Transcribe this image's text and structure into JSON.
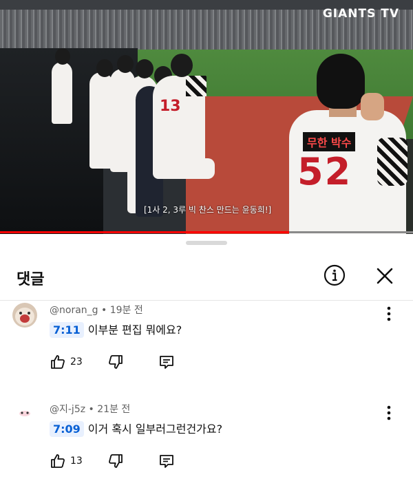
{
  "video": {
    "watermark": "GIANTS TV",
    "caption": "[1사 2, 3루 빅 찬스 만드는 윤동희!]",
    "name_tag": "무한 박수",
    "jersey_number": "52",
    "progress_fraction": 0.7
  },
  "panel": {
    "title": "댓글",
    "info_icon": "info-icon",
    "close_icon": "close-icon"
  },
  "comments": [
    {
      "author": "@noran_g",
      "time_ago": "19분 전",
      "timestamp": "7:11",
      "text": "이부분 편집 뭐에요?",
      "likes": "23"
    },
    {
      "author": "@지-j5z",
      "time_ago": "21분 전",
      "timestamp": "7:09",
      "text": "이거 혹시 일부러그런건가요?",
      "likes": "13"
    }
  ],
  "colors": {
    "accent_red": "#ff0000",
    "timestamp_blue": "#065fd4",
    "timestamp_bg": "#e8f0fe"
  }
}
